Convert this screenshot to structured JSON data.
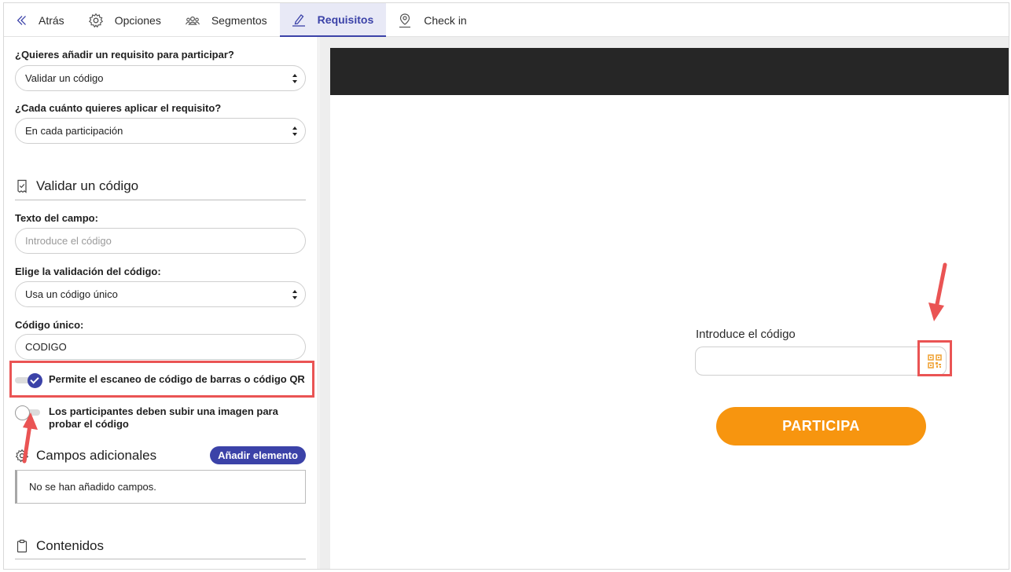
{
  "nav": {
    "back": "Atrás",
    "options": "Opciones",
    "segments": "Segmentos",
    "requirements": "Requisitos",
    "checkin": "Check in"
  },
  "form": {
    "requirement_question": "¿Quieres añadir un requisito para participar?",
    "requirement_value": "Validar un código",
    "frequency_question": "¿Cada cuánto quieres aplicar el requisito?",
    "frequency_value": "En cada participación",
    "section_title": "Validar un código",
    "field_text_label": "Texto del campo:",
    "field_text_placeholder": "Introduce el código",
    "validation_label": "Elige la validación del código:",
    "validation_value": "Usa un código único",
    "unique_code_label": "Código único:",
    "unique_code_value": "CODIGO",
    "scan_toggle_label": "Permite el escaneo de código de barras o código QR",
    "scan_toggle_on": true,
    "image_toggle_label_line1": "Los participantes deben subir una imagen para",
    "image_toggle_label_line2": "probar el código",
    "image_toggle_on": false,
    "extra_fields_title": "Campos adicionales",
    "add_element": "Añadir elemento",
    "no_fields": "No se han añadido campos.",
    "contents_title": "Contenidos"
  },
  "preview": {
    "input_label": "Introduce el código",
    "button_label": "PARTICIPA"
  },
  "colors": {
    "accent": "#3b42a8",
    "cta": "#f7950f",
    "annotation": "#ea5454",
    "banner": "#262626"
  }
}
